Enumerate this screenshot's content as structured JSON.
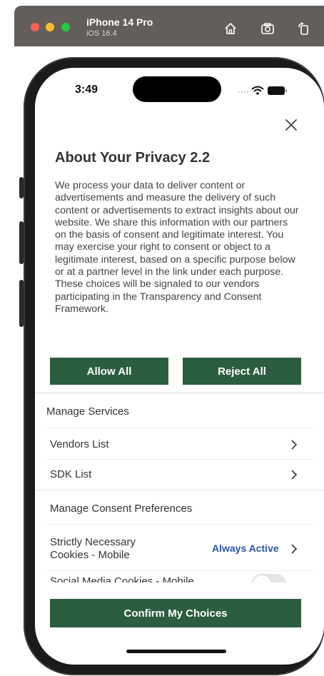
{
  "simulator": {
    "device_name": "iPhone 14 Pro",
    "os_version": "iOS 16.4",
    "home_icon": "home-icon",
    "screenshot_icon": "camera-icon",
    "rotate_icon": "rotate-icon"
  },
  "status_bar": {
    "time": "3:49",
    "wifi_icon": "wifi-icon",
    "battery_icon": "battery-icon"
  },
  "dialog": {
    "close_icon": "close-icon",
    "title": "About Your Privacy 2.2",
    "description": "We process your data to deliver content or advertisements and measure the delivery of such content or advertisements to extract insights about our website. We share this information with our partners on the basis of consent and legitimate interest. You may exercise your right to consent or object to a legitimate interest, based on a specific purpose below or at a partner level in the link under each purpose. These choices will be signaled to our vendors participating in the Transparency and Consent Framework.",
    "allow_all_label": "Allow All",
    "reject_all_label": "Reject All",
    "manage_services": {
      "heading": "Manage Services",
      "items": [
        {
          "label": "Vendors List"
        },
        {
          "label": "SDK List"
        }
      ]
    },
    "manage_consent": {
      "heading": "Manage Consent Preferences",
      "items": [
        {
          "label_line1": "Strictly Necessary",
          "label_line2": "Cookies - Mobile",
          "status": "Always Active"
        },
        {
          "label": "Social Media Cookies - Mobile",
          "toggle_on": false
        }
      ]
    },
    "confirm_label": "Confirm My Choices"
  },
  "colors": {
    "primary_button": "#2b5e3e",
    "link_blue": "#2b54a5",
    "text": "#333333"
  }
}
